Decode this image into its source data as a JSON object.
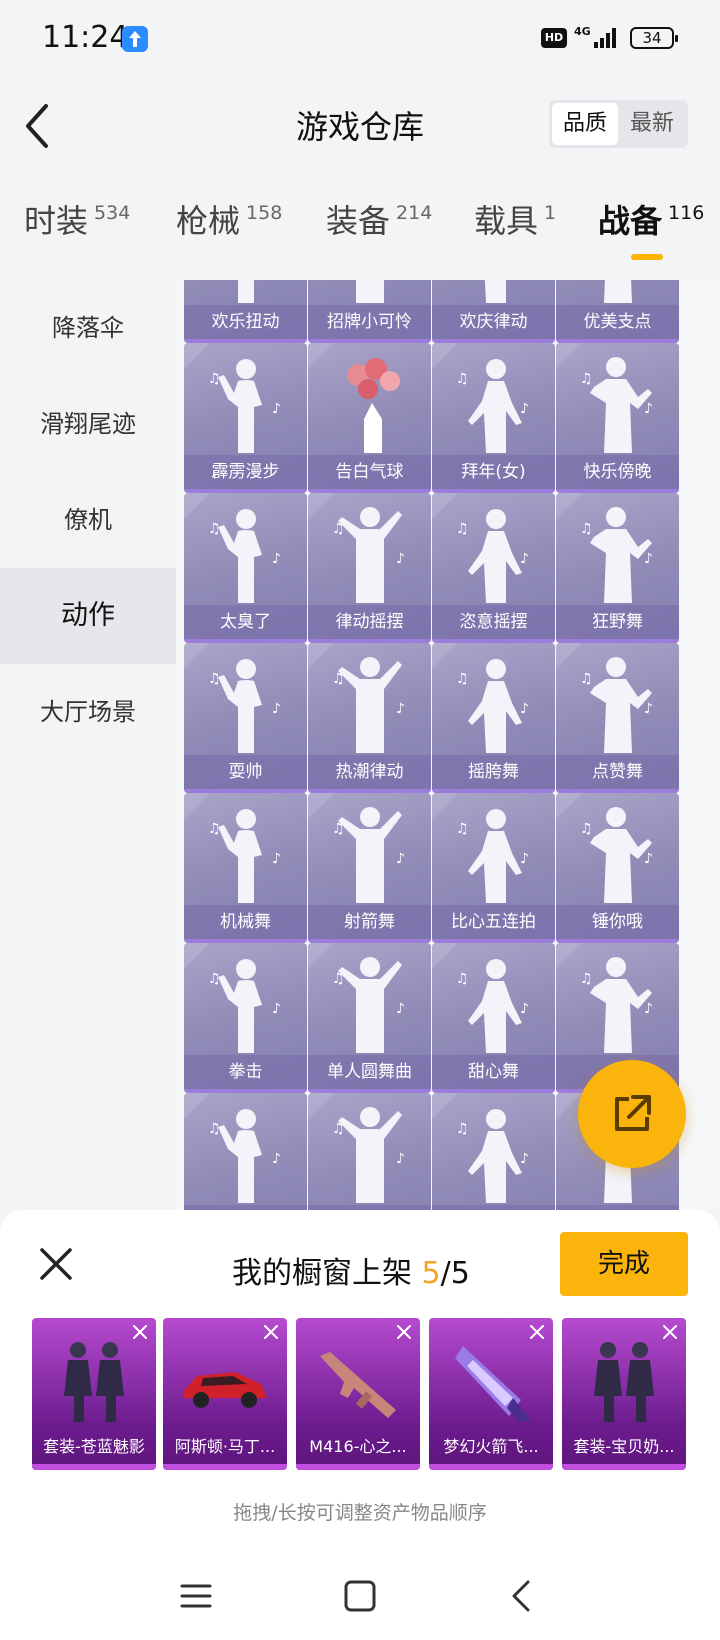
{
  "status": {
    "time": "11:24",
    "hd": "HD",
    "network": "4G",
    "battery": "34"
  },
  "header": {
    "title": "游戏仓库",
    "sort": {
      "option_1": "品质",
      "option_2": "最新",
      "active": "品质"
    }
  },
  "categories": [
    {
      "name": "时装",
      "count": "534"
    },
    {
      "name": "枪械",
      "count": "158"
    },
    {
      "name": "装备",
      "count": "214"
    },
    {
      "name": "载具",
      "count": "1"
    },
    {
      "name": "战备",
      "count": "116",
      "active": true
    }
  ],
  "sidebar": {
    "items": [
      {
        "label": "降落伞"
      },
      {
        "label": "滑翔尾迹"
      },
      {
        "label": "僚机"
      },
      {
        "label": "动作",
        "active": true
      },
      {
        "label": "大厅场景"
      }
    ]
  },
  "grid": {
    "items": [
      {
        "label": "欢乐扭动",
        "icon": "dance-pose-icon"
      },
      {
        "label": "招牌小可怜",
        "icon": "dance-pose-icon"
      },
      {
        "label": "欢庆律动",
        "icon": "dance-pose-icon"
      },
      {
        "label": "优美支点",
        "icon": "dance-pose-icon"
      },
      {
        "label": "霹雳漫步",
        "icon": "dance-pose-icon"
      },
      {
        "label": "告白气球",
        "icon": "heart-balloons-icon"
      },
      {
        "label": "拜年(女)",
        "icon": "dance-pose-icon"
      },
      {
        "label": "快乐傍晚",
        "icon": "dance-pose-icon"
      },
      {
        "label": "太臭了",
        "icon": "dance-pose-icon"
      },
      {
        "label": "律动摇摆",
        "icon": "dance-pose-icon"
      },
      {
        "label": "恣意摇摆",
        "icon": "dance-pose-icon"
      },
      {
        "label": "狂野舞",
        "icon": "dance-pose-icon"
      },
      {
        "label": "耍帅",
        "icon": "dance-pose-icon"
      },
      {
        "label": "热潮律动",
        "icon": "dance-pose-icon"
      },
      {
        "label": "摇胯舞",
        "icon": "dance-pose-icon"
      },
      {
        "label": "点赞舞",
        "icon": "dance-pose-icon"
      },
      {
        "label": "机械舞",
        "icon": "dance-pose-icon"
      },
      {
        "label": "射箭舞",
        "icon": "dance-pose-icon"
      },
      {
        "label": "比心五连拍",
        "icon": "dance-pose-icon"
      },
      {
        "label": "锤你哦",
        "icon": "dance-pose-icon"
      },
      {
        "label": "拳击",
        "icon": "dance-pose-icon"
      },
      {
        "label": "单人圆舞曲",
        "icon": "dance-pose-icon"
      },
      {
        "label": "甜心舞",
        "icon": "dance-pose-icon"
      },
      {
        "label": "",
        "icon": "dance-pose-icon"
      },
      {
        "label": "",
        "icon": "dance-pose-icon"
      },
      {
        "label": "",
        "icon": "dance-pose-icon"
      },
      {
        "label": "",
        "icon": "dance-pose-icon"
      },
      {
        "label": "",
        "icon": "dance-pose-icon"
      }
    ]
  },
  "fab": {
    "icon": "share-external-icon"
  },
  "showcase": {
    "title_prefix": "我的橱窗上架",
    "used": "5",
    "separator": "/",
    "total": "5",
    "done_label": "完成",
    "items": [
      {
        "label": "套装-苍蓝魅影",
        "icon": "outfit-icon"
      },
      {
        "label": "阿斯顿·马丁...",
        "icon": "car-icon"
      },
      {
        "label": "M416-心之...",
        "icon": "rifle-icon"
      },
      {
        "label": "梦幻火箭飞...",
        "icon": "glider-icon"
      },
      {
        "label": "套装-宝贝奶...",
        "icon": "outfit-icon"
      }
    ],
    "hint": "拖拽/长按可调整资产物品顺序"
  },
  "colors": {
    "accent": "#fbb40c",
    "card": "#9a95c0",
    "showcase_card": "#8e2aae"
  }
}
